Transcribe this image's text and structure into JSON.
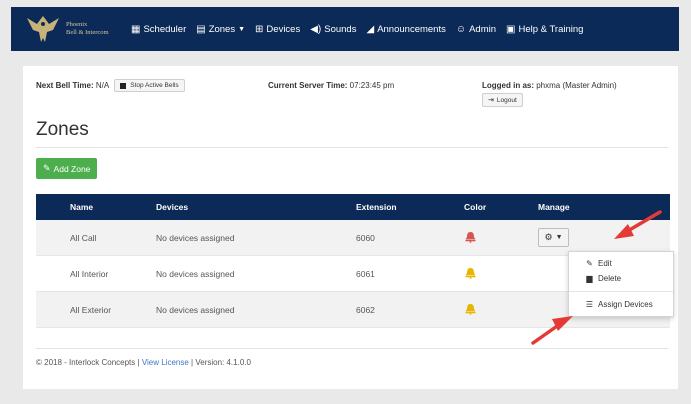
{
  "brand": {
    "line1": "Phoenix",
    "line2": "Bell & Intercom"
  },
  "nav": [
    {
      "label": "Scheduler",
      "icon": "calendar-icon"
    },
    {
      "label": "Zones",
      "icon": "zones-icon",
      "dropdown": true
    },
    {
      "label": "Devices",
      "icon": "devices-icon"
    },
    {
      "label": "Sounds",
      "icon": "speaker-icon"
    },
    {
      "label": "Announcements",
      "icon": "megaphone-icon"
    },
    {
      "label": "Admin",
      "icon": "users-icon"
    },
    {
      "label": "Help & Training",
      "icon": "help-icon"
    }
  ],
  "status": {
    "next_bell_label": "Next Bell Time:",
    "next_bell_value": "N/A",
    "stop_button": "Stop Active Bells",
    "server_time_label": "Current Server Time:",
    "server_time_value": "07:23:45 pm",
    "logged_in_label": "Logged in as:",
    "logged_in_value": "phxma (Master Admin)",
    "logout_button": "Logout"
  },
  "page_title": "Zones",
  "add_zone_button": "Add Zone",
  "table": {
    "headers": [
      "Name",
      "Devices",
      "Extension",
      "Color",
      "Manage"
    ],
    "rows": [
      {
        "name": "All Call",
        "devices": "No devices assigned",
        "extension": "6060",
        "color": "#d9534f"
      },
      {
        "name": "All Interior",
        "devices": "No devices assigned",
        "extension": "6061",
        "color": "#e8b600"
      },
      {
        "name": "All Exterior",
        "devices": "No devices assigned",
        "extension": "6062",
        "color": "#e8b600"
      }
    ]
  },
  "manage_menu": {
    "edit": "Edit",
    "delete": "Delete",
    "assign": "Assign Devices"
  },
  "footer": {
    "copyright": "© 2018 - Interlock Concepts |",
    "license_link": "View License",
    "version": "| Version: 4.1.0.0"
  },
  "colors": {
    "navbar": "#0b2a57",
    "add_button": "#4cae4c",
    "arrow": "#e53935"
  }
}
